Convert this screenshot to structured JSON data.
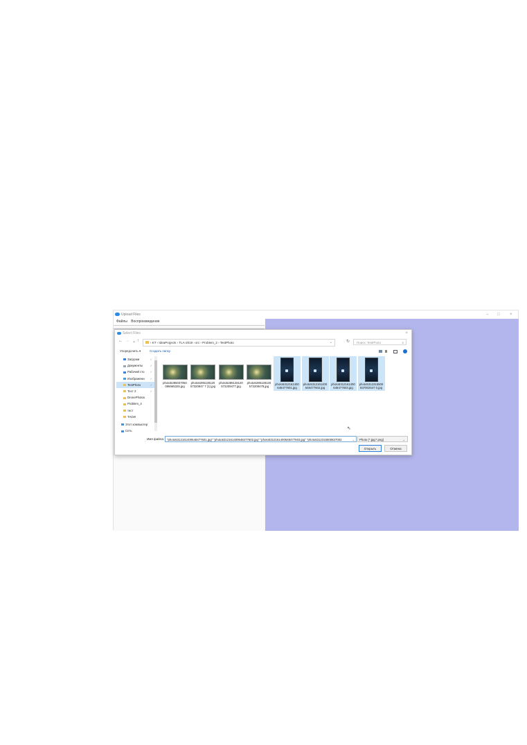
{
  "app": {
    "title": "Upload Files",
    "menu": [
      "Файлы",
      "Воспроизведение"
    ],
    "controls": {
      "minimize": "–",
      "maximize": "□",
      "close": "×"
    },
    "colors": {
      "canvas": "#b3b6ec",
      "accent": "#2f8be6"
    }
  },
  "dialog": {
    "title": "Select Files",
    "close": "×",
    "nav": {
      "back": "←",
      "forward": "→",
      "recent": "⌄",
      "up": "↑"
    },
    "breadcrumb": "› KT › IdeaProjects › TLA-2019 › src › Problem_2 › TestPhoto",
    "refresh": "↻",
    "search_placeholder": "Поиск: TestPhoto",
    "toolbar": {
      "organize": "Упорядочить ▾",
      "new_folder": "Создать папку"
    },
    "sidebar": [
      {
        "label": "Загрузки",
        "icon": "download-icon",
        "pinned": true
      },
      {
        "label": "Документы",
        "icon": "documents-icon",
        "pinned": true
      },
      {
        "label": "Рабочий сто",
        "icon": "desktop-icon",
        "pinned": true
      },
      {
        "label": "Изображени",
        "icon": "pictures-icon",
        "pinned": true
      },
      {
        "label": "TestPhoto",
        "icon": "folder-icon",
        "pinned": true,
        "selected": true
      },
      {
        "label": "Тест 2",
        "icon": "folder-icon",
        "pinned": true
      },
      {
        "label": "DronePhotos",
        "icon": "folder-icon",
        "pinned": false
      },
      {
        "label": "Problem_4",
        "icon": "folder-icon",
        "pinned": false
      },
      {
        "label": "тест",
        "icon": "folder-icon",
        "pinned": false
      },
      {
        "label": "ТАОИ",
        "icon": "folder-icon",
        "pinned": false
      },
      {
        "label": "Этот компьютер",
        "icon": "computer-icon",
        "pinned": false
      },
      {
        "label": "Сеть",
        "icon": "network-icon",
        "pinned": false
      }
    ],
    "files": [
      {
        "name": "photo5285037050086665325.jpg",
        "kind": "wide",
        "selected": false
      },
      {
        "name": "photo528512812057320947 7 (1).jpg",
        "kind": "wide",
        "selected": false
      },
      {
        "name": "photo5285128120573209477.jpg",
        "kind": "wide",
        "selected": false
      },
      {
        "name": "photo5285128120573209478.jpg",
        "kind": "wide",
        "selected": false
      },
      {
        "name": "photo5312161400648477601.jpg",
        "kind": "tall",
        "selected": true
      },
      {
        "name": "photo5312161400648477602.jpg",
        "kind": "tall",
        "selected": true
      },
      {
        "name": "photo5312161400648477603.jpg",
        "kind": "tall",
        "selected": true
      },
      {
        "name": "photo5312315500837002547 0.jpg",
        "kind": "tall",
        "selected": true
      }
    ],
    "filename_label": "Имя файла:",
    "filename_value": "\"photo5312161400648477601.jpg\" \"photo5312161400648477602.jpg\" \"photo5312161400648477603.jpg\" \"photo5312315500837002",
    "filetype": "Photo (*.jpg;*.png)",
    "open_button": "Открыть",
    "cancel_button": "Отмена"
  }
}
